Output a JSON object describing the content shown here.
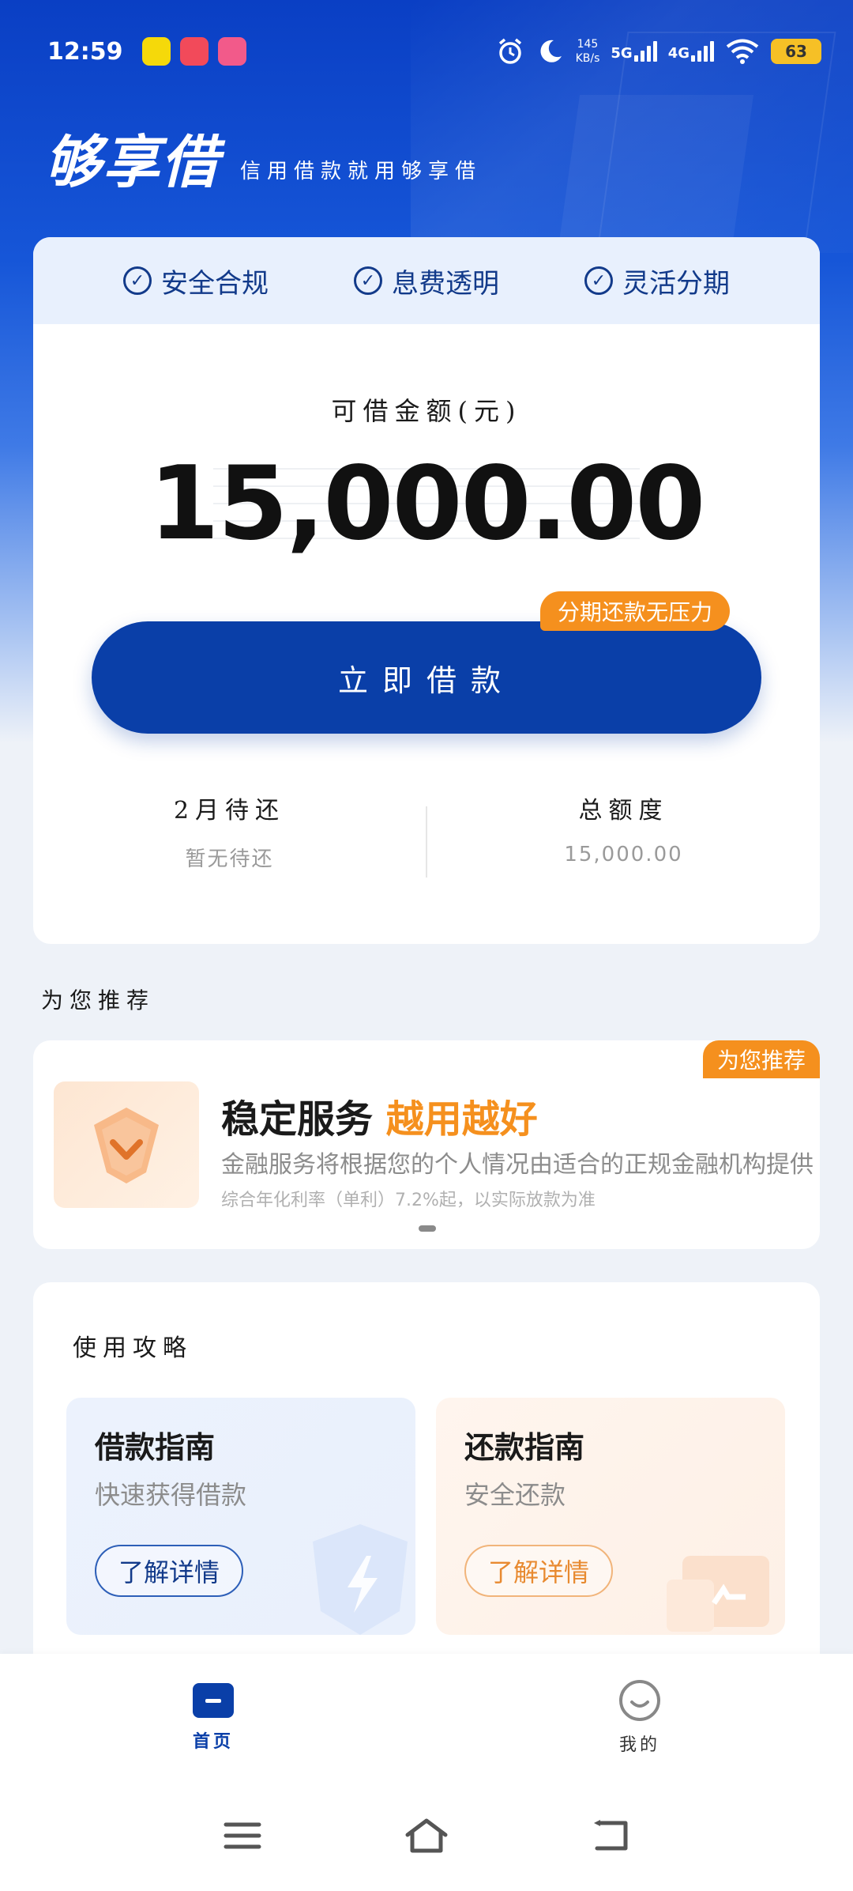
{
  "status_bar": {
    "time": "12:59",
    "net_speed_value": "145",
    "net_speed_unit": "KB/s",
    "signal_1": "5G",
    "signal_2": "4G",
    "battery": "63"
  },
  "brand": {
    "logo": "够享借",
    "slogan": "信用借款就用够享借"
  },
  "features": [
    "安全合规",
    "息费透明",
    "灵活分期"
  ],
  "limit": {
    "label": "可借金额(元)",
    "amount": "15,000.00"
  },
  "borrow_button": {
    "label": "立即借款",
    "badge": "分期还款无压力"
  },
  "stats": {
    "due_title": "2月待还",
    "due_value": "暂无待还",
    "total_title": "总额度",
    "total_value": "15,000.00"
  },
  "recommend": {
    "section_title": "为您推荐",
    "badge": "为您推荐",
    "title_main": "稳定服务",
    "title_highlight": "越用越好",
    "description": "金融服务将根据您的个人情况由适合的正规金融机构提供",
    "note": "综合年化利率（单利）7.2%起，以实际放款为准"
  },
  "guide": {
    "section_title": "使用攻略",
    "loan": {
      "title": "借款指南",
      "subtitle": "快速获得借款",
      "button": "了解详情"
    },
    "repay": {
      "title": "还款指南",
      "subtitle": "安全还款",
      "button": "了解详情"
    }
  },
  "tabs": [
    {
      "label": "首页"
    },
    {
      "label": "我的"
    }
  ],
  "colors": {
    "primary": "#0a3fa8",
    "accent": "#f5901e",
    "background": "#eef2f8"
  }
}
